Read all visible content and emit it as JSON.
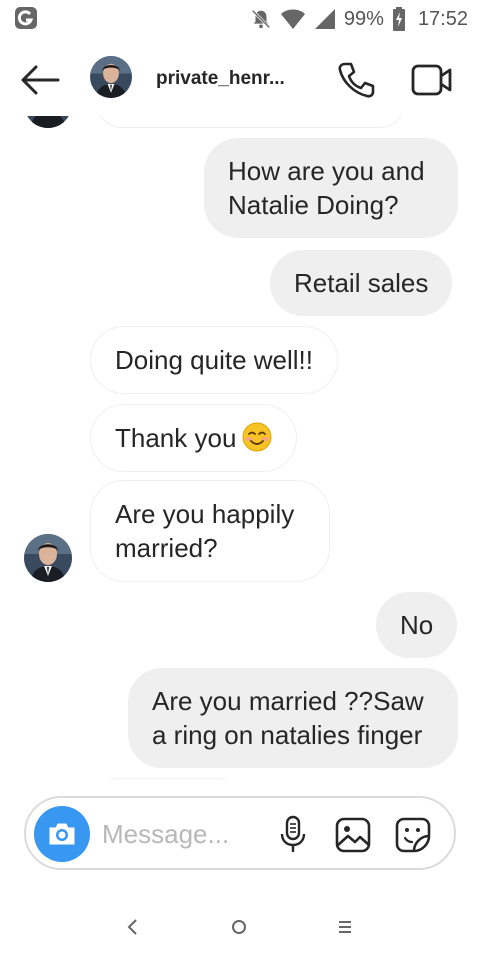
{
  "status_bar": {
    "battery": "99%",
    "time": "17:52"
  },
  "header": {
    "username": "private_henr..."
  },
  "messages": [
    {
      "direction": "sent",
      "text": "How are you and Natalie Doing?"
    },
    {
      "direction": "sent",
      "text": "Retail sales"
    },
    {
      "direction": "received",
      "text": "Doing quite well!!"
    },
    {
      "direction": "received",
      "text": "Thank you",
      "emoji": "smiling-face"
    },
    {
      "direction": "received",
      "text": "Are you happily married?"
    },
    {
      "direction": "sent",
      "text": "No"
    },
    {
      "direction": "sent",
      "text": "Are you married ??Saw a ring on natalies finger"
    }
  ],
  "composer": {
    "placeholder": "Message..."
  },
  "colors": {
    "accent": "#3897f0",
    "sent_bubble": "#efefef",
    "text": "#262626"
  },
  "icons": {
    "status_left": "app-notification-icon",
    "mute": "bell-off-icon",
    "wifi": "wifi-icon",
    "signal": "signal-icon",
    "battery": "battery-charging-icon",
    "back": "arrow-left-icon",
    "call": "phone-icon",
    "video": "video-camera-icon",
    "camera": "camera-icon",
    "mic": "microphone-icon",
    "gallery": "image-icon",
    "sticker": "sticker-icon"
  }
}
